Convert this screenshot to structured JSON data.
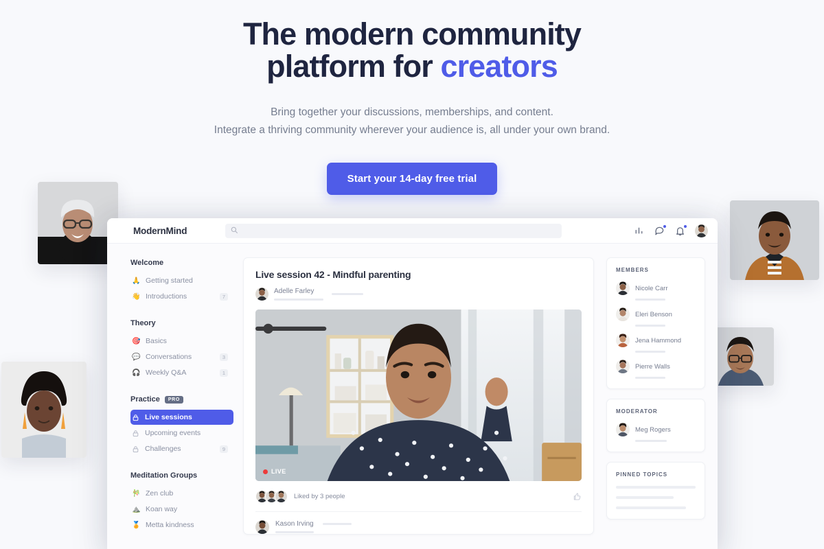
{
  "hero": {
    "headline_part1": "The modern community",
    "headline_part2": "platform for ",
    "headline_accent": "creators",
    "sub_line1": "Bring together your discussions, memberships, and content.",
    "sub_line2": "Integrate a thriving community wherever your audience is, all under your own brand.",
    "cta_label": "Start your 14-day free trial",
    "accent_color": "#4f5ce8"
  },
  "app": {
    "brand": "ModernMind",
    "search": {
      "value": "",
      "placeholder": ""
    },
    "topbar_icons": [
      {
        "name": "analytics-icon",
        "badge": false
      },
      {
        "name": "chat-bubble-icon",
        "badge": true
      },
      {
        "name": "bell-icon",
        "badge": true
      }
    ],
    "account_avatar": "user-avatar"
  },
  "sidebar": {
    "sections": [
      {
        "title": "Welcome",
        "badge": null,
        "items": [
          {
            "label": "Getting started",
            "emoji": "🙏",
            "count": "",
            "locked": false,
            "active": false
          },
          {
            "label": "Introductions",
            "emoji": "👋",
            "count": "7",
            "locked": false,
            "active": false
          }
        ]
      },
      {
        "title": "Theory",
        "badge": null,
        "items": [
          {
            "label": "Basics",
            "emoji": "🎯",
            "count": "",
            "locked": false,
            "active": false
          },
          {
            "label": "Conversations",
            "emoji": "💬",
            "count": "3",
            "locked": false,
            "active": false
          },
          {
            "label": "Weekly Q&A",
            "emoji": "🎧",
            "count": "1",
            "locked": false,
            "active": false
          }
        ]
      },
      {
        "title": "Practice",
        "badge": "PRO",
        "items": [
          {
            "label": "Live sessions",
            "emoji": "",
            "count": "",
            "locked": true,
            "active": true
          },
          {
            "label": "Upcoming events",
            "emoji": "",
            "count": "",
            "locked": true,
            "active": false
          },
          {
            "label": "Challenges",
            "emoji": "",
            "count": "9",
            "locked": true,
            "active": false
          }
        ]
      },
      {
        "title": "Meditation Groups",
        "badge": null,
        "items": [
          {
            "label": "Zen club",
            "emoji": "🎋",
            "count": "",
            "locked": false,
            "active": false
          },
          {
            "label": "Koan way",
            "emoji": "⛰️",
            "count": "",
            "locked": false,
            "active": false
          },
          {
            "label": "Metta kindness",
            "emoji": "🏅",
            "count": "",
            "locked": false,
            "active": false
          }
        ]
      }
    ]
  },
  "post": {
    "title": "Live session 42 - Mindful parenting",
    "author": "Adelle Farley",
    "live_label": "LIVE",
    "likes_text": "Liked by 3 people",
    "like_button": "thumbs-up-icon",
    "comment_author": "Kason Irving"
  },
  "rail": {
    "members_title": "MEMBERS",
    "members": [
      {
        "name": "Nicole Carr"
      },
      {
        "name": "Eleri Benson"
      },
      {
        "name": "Jena Hammond"
      },
      {
        "name": "Pierre Walls"
      }
    ],
    "moderator_title": "MODERATOR",
    "moderator": {
      "name": "Meg Rogers"
    },
    "pinned_title": "PINNED TOPICS",
    "pinned_placeholder_count": 3
  }
}
